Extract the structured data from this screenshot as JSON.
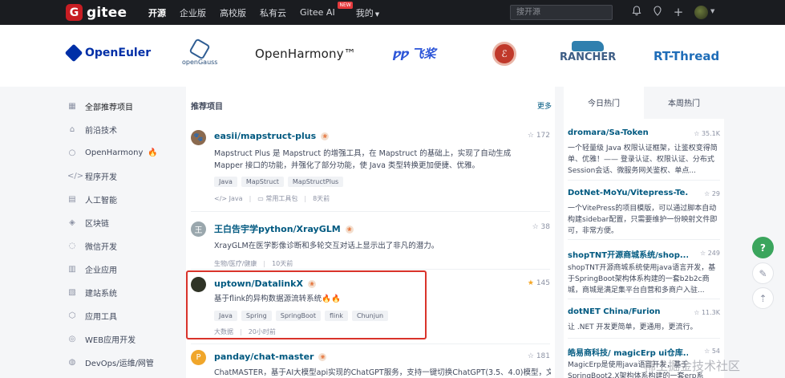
{
  "brand": {
    "logo_letter": "G",
    "name": "gitee"
  },
  "nav": {
    "items": [
      "开源",
      "企业版",
      "高校版",
      "私有云",
      "Gitee AI",
      "我的"
    ],
    "new_badge": "NEW",
    "search_placeholder": "搜开源"
  },
  "partners": [
    "OpenEuler",
    "openGauss",
    "OpenHarmony™",
    "飞桨",
    "RANCHER",
    "RT-Thread"
  ],
  "sidebar": {
    "items": [
      {
        "label": "全部推荐项目",
        "icon": "grid-icon"
      },
      {
        "label": "前沿技术",
        "icon": "robot-icon"
      },
      {
        "label": "OpenHarmony",
        "icon": "harmony-icon"
      },
      {
        "label": "程序开发",
        "icon": "code-icon"
      },
      {
        "label": "人工智能",
        "icon": "ai-icon"
      },
      {
        "label": "区块链",
        "icon": "blockchain-icon"
      },
      {
        "label": "微信开发",
        "icon": "wechat-icon"
      },
      {
        "label": "企业应用",
        "icon": "enterprise-icon"
      },
      {
        "label": "建站系统",
        "icon": "site-icon"
      },
      {
        "label": "应用工具",
        "icon": "tool-icon"
      },
      {
        "label": "WEB应用开发",
        "icon": "web-icon"
      },
      {
        "label": "DevOps/运维/网管",
        "icon": "devops-icon"
      }
    ]
  },
  "main": {
    "heading": "推荐项目",
    "more": "更多",
    "projects": [
      {
        "title": "easii/mapstruct-plus",
        "stars": "172",
        "desc": "Mapstruct Plus 是 Mapstruct 的增强工具，在 Mapstruct 的基础上，实现了自动生成 Mapper 接口的功能，并强化了部分功能，使 Java 类型转换更加便捷、优雅。",
        "tags": [
          "Java",
          "MapStruct",
          "MapStructPlus"
        ],
        "lang": "Java",
        "category": "常用工具包",
        "time": "8天前",
        "avatar_color": "#8b6a4f"
      },
      {
        "title": "王白告宇学python/XrayGLM",
        "stars": "38",
        "desc": "XrayGLM在医学影像诊断和多轮交互对话上显示出了非凡的潜力。",
        "tags": [],
        "category": "生物/医疗/健康",
        "time": "10天前",
        "avatar_letter": "王",
        "avatar_color": "#9aa7ad"
      },
      {
        "title": "uptown/DatalinkX",
        "stars": "145",
        "desc": "基于flink的异构数据源流转系统🔥🔥",
        "tags": [
          "Java",
          "Spring",
          "SpringBoot",
          "flink",
          "Chunjun"
        ],
        "category": "大数据",
        "time": "20小时前",
        "avatar_color": "#2f3326"
      },
      {
        "title": "panday/chat-master",
        "stars": "181",
        "desc": "ChatMASTER，基于AI大模型api实现的ChatGPT服务，支持一键切换ChatGPT(3.5、4.0)模型，文",
        "avatar_letter": "P",
        "avatar_color": "#f0a62b"
      }
    ]
  },
  "hot": {
    "tabs": [
      "今日热门",
      "本周热门"
    ],
    "items": [
      {
        "title": "dromara/Sa-Token",
        "stars": "35.1K",
        "desc": "一个轻量级 Java 权限认证框架，让鉴权变得简单、优雅！—— 登录认证、权限认证、分布式Session会话、微服务网关鉴权、单点..."
      },
      {
        "title": "DotNet-MoYu/Vitepress-Te...",
        "stars": "29",
        "desc": "一个VitePress的项目模版，可以通过脚本自动构建sidebar配置，只需要维护一份映射文件即可，非常方便。"
      },
      {
        "title": "shopTNT开源商城系统/shop...",
        "stars": "249",
        "desc": "shopTNT开源商城系统使用java语言开发，基于SpringBoot架构体系构建的一套b2b2c商城，商城是满足集平台自营和多商户入驻..."
      },
      {
        "title": "dotNET China/Furion",
        "stars": "11.3K",
        "desc": "让 .NET 开发更简单，更通用，更流行。"
      },
      {
        "title": "皓易商科技/ magicErp ui仓库...",
        "stars": "54",
        "desc": "MagicErp是使用java语言开发，基于SpringBoot2.X架构体系构建的一套erp系"
      }
    ]
  },
  "fab": {
    "help": "?",
    "edit": "✎",
    "top": "⇡"
  },
  "watermark": "稀土掘金技术社区"
}
